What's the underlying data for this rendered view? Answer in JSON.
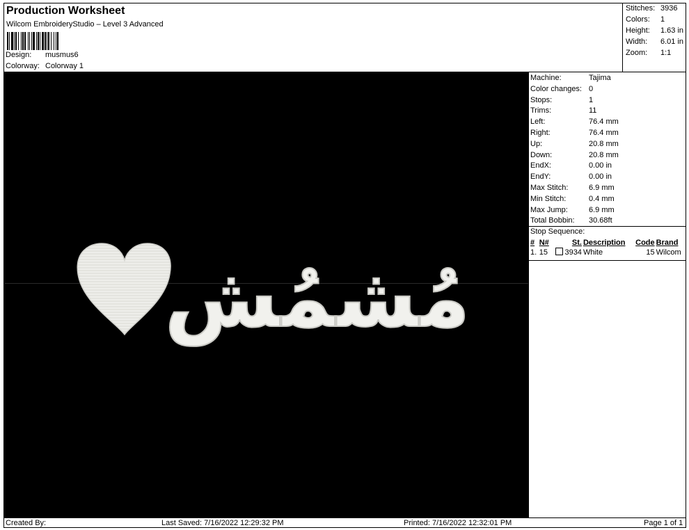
{
  "header": {
    "title": "Production Worksheet",
    "subtitle": "Wilcom EmbroideryStudio – Level 3 Advanced",
    "design_label": "Design:",
    "design_value": "musmus6",
    "colorway_label": "Colorway:",
    "colorway_value": "Colorway 1"
  },
  "summary": {
    "stitches_label": "Stitches:",
    "stitches": "3936",
    "colors_label": "Colors:",
    "colors": "1",
    "height_label": "Height:",
    "height": "1.63 in",
    "width_label": "Width:",
    "width": "6.01 in",
    "zoom_label": "Zoom:",
    "zoom": "1:1"
  },
  "details": {
    "rows": [
      {
        "label": "Machine:",
        "value": "Tajima"
      },
      {
        "label": "Color changes:",
        "value": "0"
      },
      {
        "label": "Stops:",
        "value": "1"
      },
      {
        "label": "Trims:",
        "value": "11"
      },
      {
        "label": "Left:",
        "value": "76.4 mm"
      },
      {
        "label": "Right:",
        "value": "76.4 mm"
      },
      {
        "label": "Up:",
        "value": "20.8 mm"
      },
      {
        "label": "Down:",
        "value": "20.8 mm"
      },
      {
        "label": "EndX:",
        "value": "0.00 in"
      },
      {
        "label": "EndY:",
        "value": "0.00 in"
      },
      {
        "label": "Max Stitch:",
        "value": "6.9 mm"
      },
      {
        "label": "Min Stitch:",
        "value": "0.4 mm"
      },
      {
        "label": "Max Jump:",
        "value": "6.9 mm"
      },
      {
        "label": "Total Bobbin:",
        "value": "30.68ft"
      }
    ],
    "stop_sequence_title": "Stop Sequence:",
    "stop_headers": [
      "#",
      "N#",
      "St.",
      "Description",
      "Code",
      "Brand"
    ],
    "stops": [
      {
        "num": "1.",
        "needle": "15",
        "stitches": "3934",
        "description": "White",
        "code": "15",
        "brand": "Wilcom"
      }
    ]
  },
  "design": {
    "text": "مُشمُش",
    "background_color": "#000000",
    "thread_color": "#f2f2ee",
    "heart_icon": "heart-icon"
  },
  "footer": {
    "created_by": "Created By:",
    "last_saved": "Last Saved: 7/16/2022 12:29:32 PM",
    "printed": "Printed: 7/16/2022 12:32:01 PM",
    "page": "Page 1 of 1"
  }
}
